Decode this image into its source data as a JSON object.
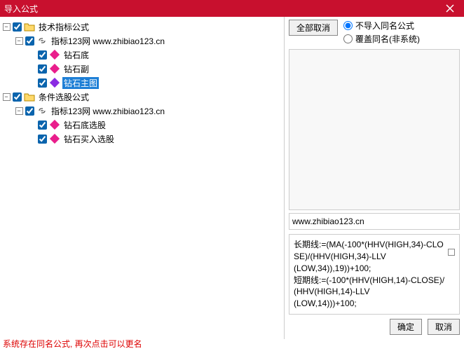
{
  "window": {
    "title": "导入公式"
  },
  "toolbar": {
    "deselect_all": "全部取消",
    "ok": "确定",
    "cancel": "取消"
  },
  "radios": {
    "no_import": "不导入同名公式",
    "overwrite": "覆盖同名(非系统)"
  },
  "tree": {
    "cat1": "技术指标公式",
    "site1": "指标123网 www.zhibiao123.cn",
    "f1": "钻石底",
    "f2": "钻石副",
    "f3": "钻石主图",
    "cat2": "条件选股公式",
    "site2": "指标123网 www.zhibiao123.cn",
    "f4": "钻石底选股",
    "f5": "钻石买入选股"
  },
  "preview": {
    "url": "www.zhibiao123.cn",
    "code": "长期线:=(MA(-100*(HHV(HIGH,34)-CLOSE)/(HHV(HIGH,34)-LLV\n(LOW,34)),19))+100;\n短期线:=(-100*(HHV(HIGH,14)-CLOSE)/(HHV(HIGH,14)-LLV\n(LOW,14)))+100;"
  },
  "status": "系统存在同名公式, 再次点击可以更名"
}
